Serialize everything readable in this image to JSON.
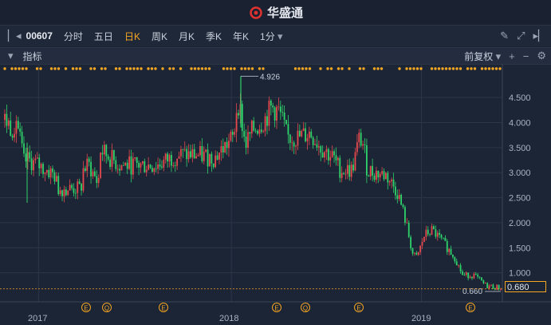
{
  "app": {
    "title": "华盛通"
  },
  "toolbar": {
    "stock_code": "00607",
    "tabs": [
      "分时",
      "五日",
      "日K",
      "周K",
      "月K",
      "季K",
      "年K"
    ],
    "active_tab": "日K",
    "interval": "1分"
  },
  "indicator_bar": {
    "label": "指标",
    "adjust_label": "前复权"
  },
  "price_box": "0.680",
  "chart_data": {
    "type": "candlestick",
    "y_ticks": [
      "4.500",
      "4.000",
      "3.500",
      "3.000",
      "2.500",
      "2.000",
      "1.500",
      "1.000"
    ],
    "ylim": [
      0.58,
      4.98
    ],
    "x_labels": [
      "2017",
      "2018",
      "2019"
    ],
    "high_label": "4.926",
    "low_label": "0.660",
    "last_price": 0.68,
    "event_markers": [
      "E",
      "Q",
      "E",
      "E",
      "Q",
      "E",
      "E"
    ],
    "colors": {
      "up": "#e5484d",
      "down": "#2fd36b",
      "marker": "#f5a623",
      "grid": "#2c3647"
    },
    "series_points": [
      [
        0.0,
        4.05
      ],
      [
        0.02,
        3.9
      ],
      [
        0.03,
        4.1
      ],
      [
        0.05,
        3.2
      ],
      [
        0.06,
        3.25
      ],
      [
        0.1,
        3.1
      ],
      [
        0.13,
        2.95
      ],
      [
        0.14,
        2.68
      ],
      [
        0.2,
        2.68
      ],
      [
        0.205,
        3.05
      ],
      [
        0.22,
        3.15
      ],
      [
        0.24,
        2.85
      ],
      [
        0.245,
        2.75
      ],
      [
        0.25,
        3.45
      ],
      [
        0.3,
        3.15
      ],
      [
        0.35,
        3.15
      ],
      [
        0.4,
        3.15
      ],
      [
        0.45,
        3.35
      ],
      [
        0.5,
        3.35
      ],
      [
        0.55,
        3.3
      ],
      [
        0.58,
        3.55
      ],
      [
        0.6,
        3.7
      ],
      [
        0.61,
        4.5
      ],
      [
        0.62,
        4.1
      ],
      [
        0.63,
        3.55
      ],
      [
        0.65,
        3.85
      ],
      [
        0.68,
        4.05
      ],
      [
        0.7,
        4.3
      ],
      [
        0.72,
        4.2
      ],
      [
        0.74,
        3.7
      ],
      [
        0.77,
        3.7
      ],
      [
        0.8,
        3.8
      ],
      [
        0.83,
        3.5
      ],
      [
        0.86,
        3.3
      ],
      [
        0.88,
        3.05
      ],
      [
        0.91,
        3.05
      ],
      [
        0.93,
        3.7
      ],
      [
        0.94,
        3.55
      ],
      [
        0.95,
        3.05
      ],
      [
        0.97,
        3.0
      ],
      [
        1.0,
        2.95
      ],
      [
        1.03,
        2.6
      ],
      [
        1.05,
        2.05
      ],
      [
        1.07,
        1.35
      ],
      [
        1.08,
        1.3
      ],
      [
        1.1,
        1.75
      ],
      [
        1.12,
        1.85
      ],
      [
        1.15,
        1.6
      ],
      [
        1.18,
        1.3
      ],
      [
        1.2,
        0.95
      ],
      [
        1.23,
        0.95
      ],
      [
        1.26,
        0.75
      ],
      [
        1.28,
        0.72
      ],
      [
        1.3,
        0.7
      ]
    ]
  }
}
